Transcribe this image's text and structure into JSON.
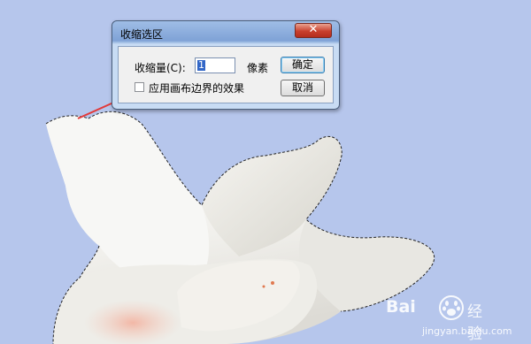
{
  "dialog": {
    "title": "收缩选区",
    "close_glyph": "✕",
    "amount_label": "收缩量(C):",
    "amount_value": "1",
    "unit_label": "像素",
    "ok_label": "确定",
    "cancel_label": "取消",
    "canvas_bounds_label": "应用画布边界的效果",
    "canvas_bounds_checked": false
  },
  "colors": {
    "canvas_background": "#b6c6ec",
    "annotation_arrow": "#e23a3a",
    "selection_highlight": "#3266c7"
  },
  "watermark": {
    "logo": "Bai",
    "text": "经验",
    "url": "jingyan.baidu.com"
  }
}
